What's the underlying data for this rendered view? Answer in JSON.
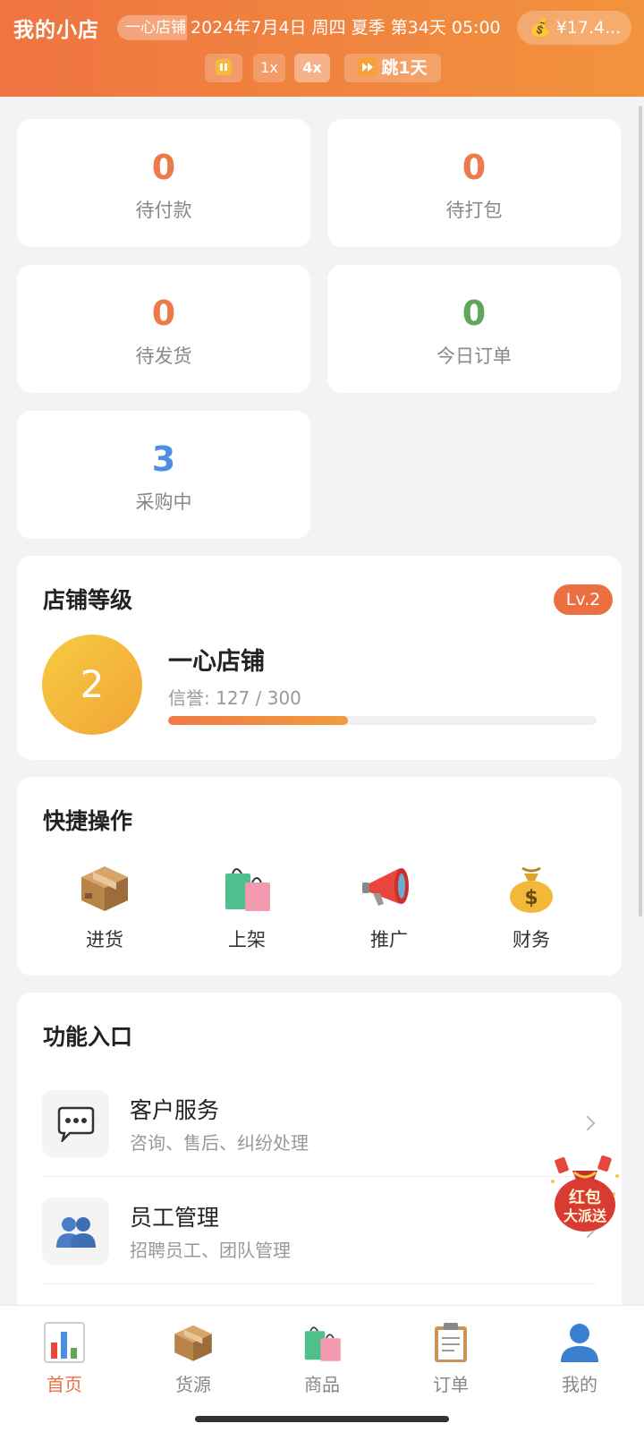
{
  "header": {
    "title": "我的小店",
    "shop_chip": "一心店铺",
    "datetime": "2024年7月4日 周四 夏季 第34天 05:00",
    "money": "¥17.4...",
    "controls": {
      "speed_1x": "1x",
      "speed_4x": "4x",
      "jump": "跳1天",
      "active_speed": "4x"
    }
  },
  "stats": [
    {
      "value": "0",
      "label": "待付款",
      "color": "#ec7a4a"
    },
    {
      "value": "0",
      "label": "待打包",
      "color": "#ec7a4a"
    },
    {
      "value": "0",
      "label": "待发货",
      "color": "#ec7a4a"
    },
    {
      "value": "0",
      "label": "今日订单",
      "color": "#5fa75a"
    },
    {
      "value": "3",
      "label": "采购中",
      "color": "#4a8fe0"
    }
  ],
  "shop_level": {
    "title": "店铺等级",
    "badge": "Lv.2",
    "level": "2",
    "shop_name": "一心店铺",
    "reputation_text": "信誉: 127 / 300",
    "progress": 0.42
  },
  "quick_actions": {
    "title": "快捷操作",
    "items": [
      {
        "label": "进货",
        "icon": "package-icon"
      },
      {
        "label": "上架",
        "icon": "shopping-bags-icon"
      },
      {
        "label": "推广",
        "icon": "megaphone-icon"
      },
      {
        "label": "财务",
        "icon": "money-bag-icon"
      }
    ]
  },
  "features": {
    "title": "功能入口",
    "items": [
      {
        "title": "客户服务",
        "subtitle": "咨询、售后、纠纷处理",
        "icon": "speech-bubble-icon"
      },
      {
        "title": "员工管理",
        "subtitle": "招聘员工、团队管理",
        "icon": "people-icon"
      }
    ]
  },
  "red_packet": {
    "line1": "红包",
    "line2": "大派送"
  },
  "tabbar": {
    "active": "首页",
    "items": [
      {
        "label": "首页",
        "icon": "bar-chart-icon"
      },
      {
        "label": "货源",
        "icon": "package-icon"
      },
      {
        "label": "商品",
        "icon": "shopping-bags-icon"
      },
      {
        "label": "订单",
        "icon": "clipboard-icon"
      },
      {
        "label": "我的",
        "icon": "user-icon"
      }
    ]
  }
}
